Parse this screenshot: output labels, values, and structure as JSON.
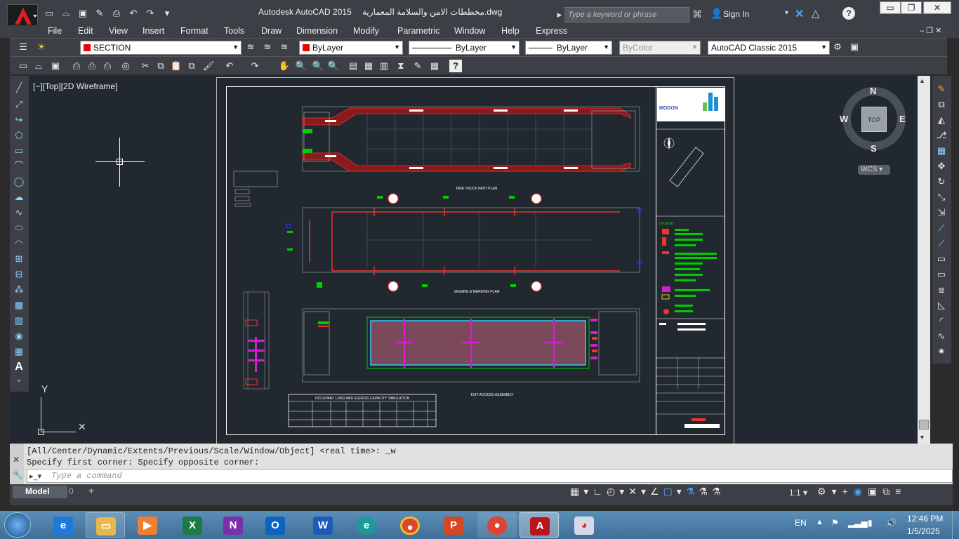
{
  "app": {
    "title": "Autodesk AutoCAD 2015",
    "file": "مخططات الامن والسلامة المعمارية.dwg"
  },
  "search": {
    "placeholder": "Type a keyword or phrase"
  },
  "signin": "Sign In",
  "menu": [
    "File",
    "Edit",
    "View",
    "Insert",
    "Format",
    "Tools",
    "Draw",
    "Dimension",
    "Modify",
    "Parametric",
    "Window",
    "Help",
    "Express"
  ],
  "layer": {
    "name": "SECTION",
    "color": "ByLayer",
    "linetype": "ByLayer",
    "lineweight": "ByLayer",
    "plotstyle": "ByColor",
    "workspace": "AutoCAD Classic 2015"
  },
  "viewport": {
    "label": "[−][Top][2D Wireframe]"
  },
  "viewcube": {
    "n": "N",
    "s": "S",
    "e": "E",
    "w": "W",
    "top": "TOP",
    "wcs": "WCS"
  },
  "drawing": {
    "plan1": "FIRE TRUCK PATH PLAN",
    "plan2": "SIGNING & MARKING PLAN",
    "plan3": "EXIT ACCESS-ASSEMBLY",
    "table_title": "OCCUPANT LOAD AND EGRESS CAPACITY TABULATION",
    "logo": "MODON",
    "legend": "LEGEND"
  },
  "ucs": {
    "y": "Y"
  },
  "command": {
    "line1": "[All/Center/Dynamic/Extents/Previous/Scale/Window/Object] <real time>: _w",
    "line2": "Specify first corner: Specify opposite corner:",
    "placeholder": "Type a command"
  },
  "tabs": {
    "model": "Model",
    "layout": "0"
  },
  "status": {
    "scale": "1:1"
  },
  "tray": {
    "lang": "EN",
    "time": "12:46 PM",
    "date": "1/5/2025"
  }
}
